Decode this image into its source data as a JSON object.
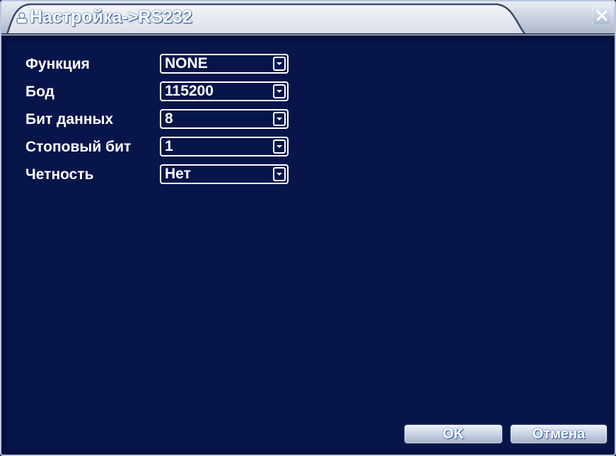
{
  "window": {
    "title": "Настройка->RS232"
  },
  "form": {
    "rows": [
      {
        "label": "Функция",
        "value": "NONE"
      },
      {
        "label": "Бод",
        "value": "115200"
      },
      {
        "label": "Бит данных",
        "value": "8"
      },
      {
        "label": "Стоповый бит",
        "value": "1"
      },
      {
        "label": "Четность",
        "value": "Нет"
      }
    ]
  },
  "buttons": {
    "ok_label": "OK",
    "cancel_label": "Отмена"
  },
  "icons": {
    "title": "settings-icon",
    "close": "close-icon",
    "dropdown": "chevron-down-icon"
  },
  "colors": {
    "background": "#08154a",
    "text": "#ffffff",
    "titlebar": "#c6cedc"
  }
}
